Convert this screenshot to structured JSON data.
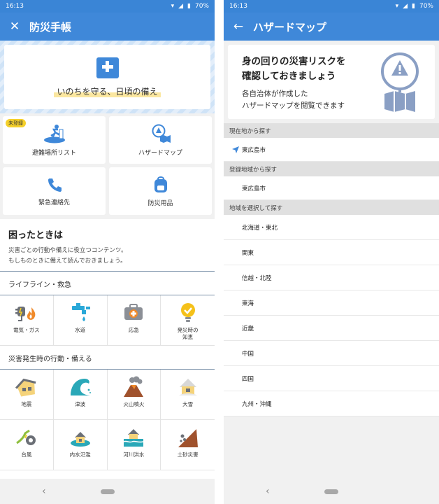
{
  "status": {
    "time": "16:13",
    "battery": "70%"
  },
  "left": {
    "title": "防災手帳",
    "slogan": "いのちを守る、日頃の備え",
    "tiles": [
      {
        "label": "避難場所リスト",
        "badge": "未登録"
      },
      {
        "label": "ハザードマップ"
      },
      {
        "label": "緊急連絡先"
      },
      {
        "label": "防災用品"
      }
    ],
    "trouble": {
      "heading": "困ったときは",
      "line1": "災害ごとの行動や備えに役立つコンテンツ。",
      "line2": "もしものときに備えて読んでおきましょう。"
    },
    "section1": {
      "title": "ライフライン・救急",
      "items": [
        "電気・ガス",
        "水道",
        "応急",
        "発災時の\n知恵"
      ]
    },
    "section2": {
      "title": "災害発生時の行動・備える",
      "items": [
        "地震",
        "津波",
        "火山噴火",
        "大雪",
        "台風",
        "内水氾濫",
        "河川洪水",
        "土砂災害"
      ]
    }
  },
  "right": {
    "title": "ハザードマップ",
    "card": {
      "heading1": "身の回りの災害リスクを",
      "heading2": "確認しておきましょう",
      "sub1": "各自治体が作成した",
      "sub2": "ハザードマップを閲覧できます"
    },
    "current_section": "現在地から探す",
    "current_item": "東広島市",
    "registered_section": "登録地域から探す",
    "registered_item": "東広島市",
    "region_section": "地域を選択して探す",
    "regions": [
      "北海道・東北",
      "関東",
      "信越・北陸",
      "東海",
      "近畿",
      "中国",
      "四国",
      "九州・沖縄"
    ]
  },
  "colors": {
    "primary": "#3f88d9",
    "accent": "#f5d02a",
    "orange": "#f08a2a"
  }
}
